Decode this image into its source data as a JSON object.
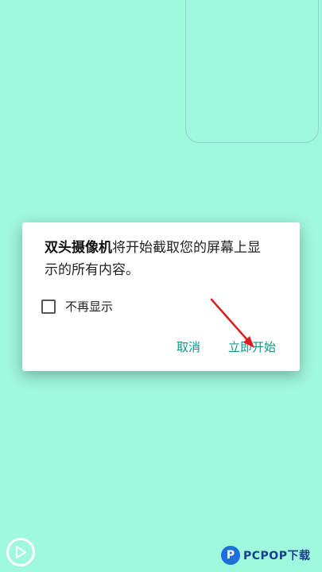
{
  "dialog": {
    "app_name": "双头摄像机",
    "message_line1_rest": "将开始截取您的屏幕上显",
    "message_line2": "示的所有内容。",
    "checkbox_label": "不再显示",
    "checkbox_checked": false,
    "cancel_label": "取消",
    "start_label": "立即开始"
  },
  "watermark": {
    "text": "PCPOP下载"
  },
  "colors": {
    "background": "#9ff7dd",
    "accent": "#0e9388",
    "arrow": "#d81e1e"
  },
  "icons": {
    "play": "play-icon",
    "arrow": "annotation-arrow"
  }
}
